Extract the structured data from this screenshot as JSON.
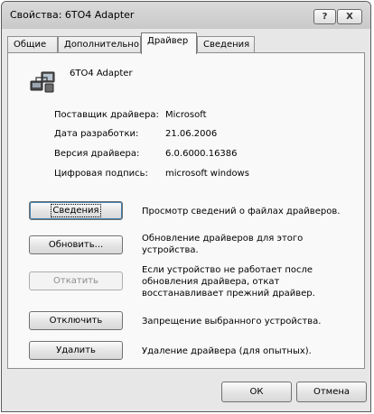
{
  "window": {
    "title": "Свойства: 6TO4 Adapter",
    "help_label": "?",
    "close_label": "X"
  },
  "tabs": [
    {
      "label": "Общие"
    },
    {
      "label": "Дополнительно"
    },
    {
      "label": "Драйвер",
      "active": true
    },
    {
      "label": "Сведения"
    }
  ],
  "device": {
    "icon": "network-adapter-icon",
    "name": "6TO4 Adapter"
  },
  "info": [
    {
      "label": "Поставщик драйвера:",
      "value": "Microsoft"
    },
    {
      "label": "Дата разработки:",
      "value": "21.06.2006"
    },
    {
      "label": "Версия драйвера:",
      "value": "6.0.6000.16386"
    },
    {
      "label": "Цифровая подпись:",
      "value": "microsoft windows"
    }
  ],
  "actions": [
    {
      "button": "Сведения",
      "desc": "Просмотр сведений о файлах драйверов.",
      "enabled": true
    },
    {
      "button": "Обновить...",
      "desc": "Обновление драйверов для этого устройства.",
      "enabled": true
    },
    {
      "button": "Откатить",
      "desc": "Если устройство не работает после обновления драйвера, откат восстанавливает прежний драйвер.",
      "enabled": false
    },
    {
      "button": "Отключить",
      "desc": "Запрещение выбранного устройства.",
      "enabled": true
    },
    {
      "button": "Удалить",
      "desc": "Удаление драйвера (для опытных).",
      "enabled": true
    }
  ],
  "footer": {
    "ok_label": "ОК",
    "cancel_label": "Отмена"
  }
}
